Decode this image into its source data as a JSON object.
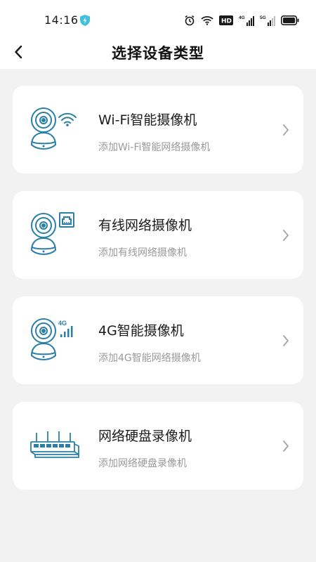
{
  "status_bar": {
    "time": "14:16",
    "hd_label": "HD",
    "network_1": "4G",
    "network_2": "5G"
  },
  "header": {
    "title": "选择设备类型"
  },
  "colors": {
    "icon_blue": "#2a7fa8",
    "shield_cyan": "#3fc1d9"
  },
  "device_types": [
    {
      "title": "Wi-Fi智能摄像机",
      "subtitle": "添加Wi-Fi智能网络摄像机",
      "icon": "wifi-camera-icon"
    },
    {
      "title": "有线网络摄像机",
      "subtitle": "添加有线网络摄像机",
      "icon": "wired-camera-icon"
    },
    {
      "title": "4G智能摄像机",
      "subtitle": "添加4G智能网络摄像机",
      "icon": "4g-camera-icon",
      "badge": "4G"
    },
    {
      "title": "网络硬盘录像机",
      "subtitle": "添加网络硬盘录像机",
      "icon": "nvr-icon"
    }
  ]
}
